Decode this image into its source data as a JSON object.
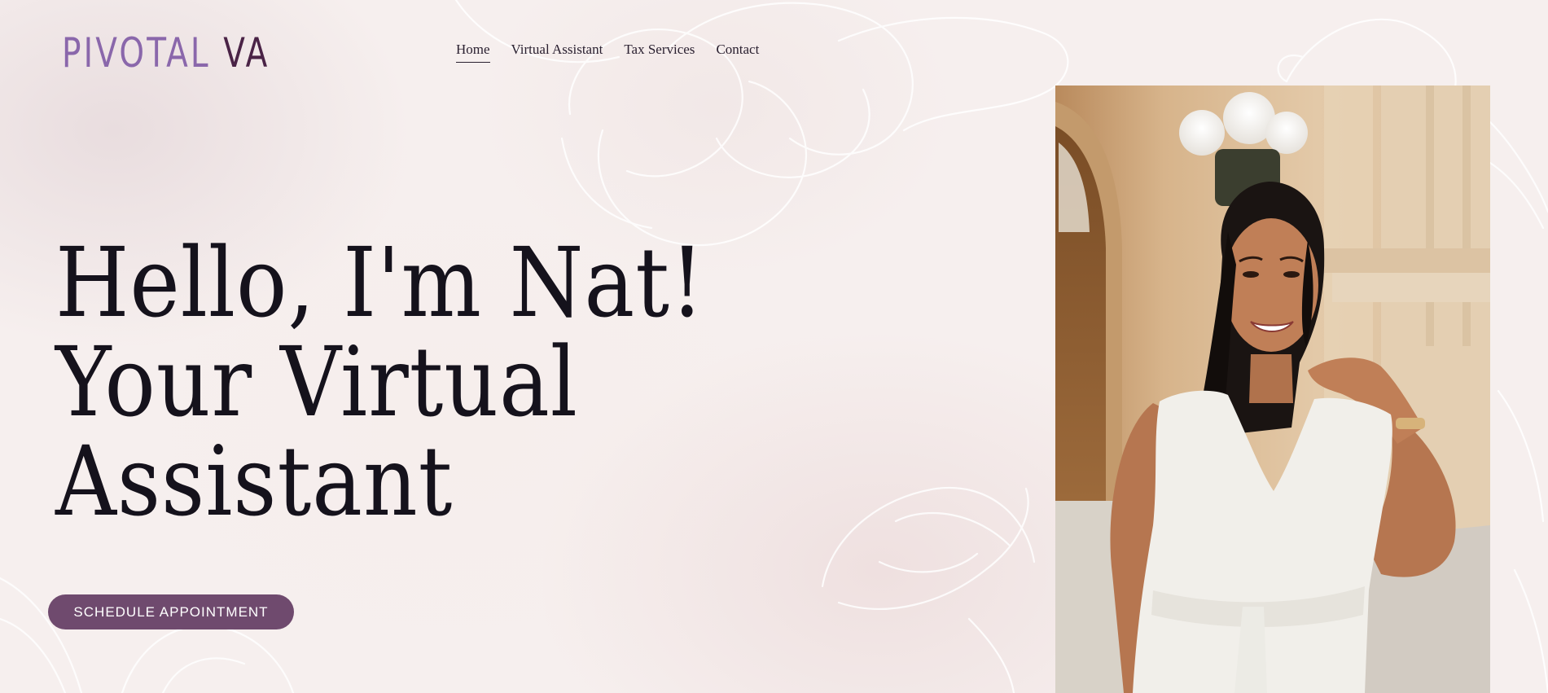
{
  "logo": {
    "part1": "PIVOTAL",
    "part2": "VA"
  },
  "nav": {
    "items": [
      {
        "label": "Home",
        "active": true
      },
      {
        "label": "Virtual Assistant",
        "active": false
      },
      {
        "label": "Tax Services",
        "active": false
      },
      {
        "label": "Contact",
        "active": false
      }
    ]
  },
  "hero": {
    "line1": "Hello, I'm Nat!",
    "line2": "Your Virtual",
    "line3": "Assistant",
    "cta_label": "SCHEDULE APPOINTMENT"
  },
  "photo": {
    "subject": "portrait-photo"
  },
  "colors": {
    "background": "#f6efee",
    "logo_light": "#8a67ab",
    "logo_dark": "#4a2346",
    "button": "#6f4a6e",
    "text": "#15121c"
  }
}
